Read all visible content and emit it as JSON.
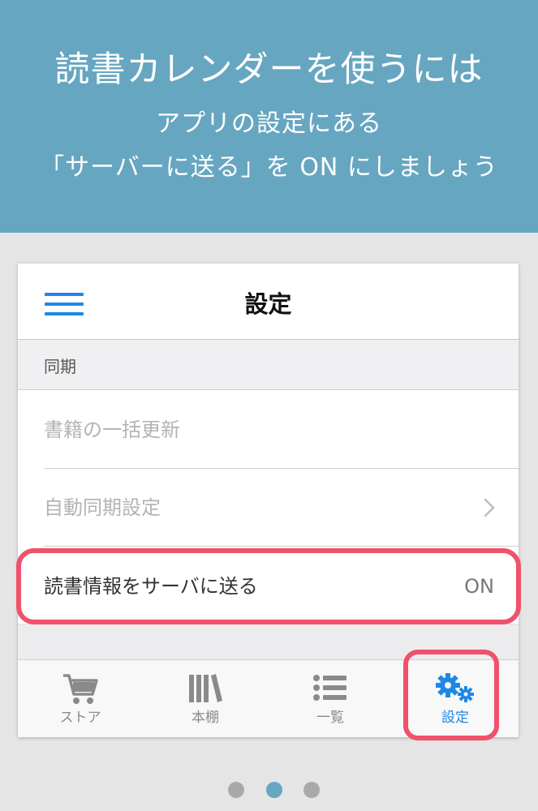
{
  "banner": {
    "title": "読書カレンダーを使うには",
    "line1": "アプリの設定にある",
    "line2": "「サーバーに送る」を ON にしましょう",
    "color": "#67a6c0"
  },
  "header": {
    "title": "設定",
    "menu_icon": "hamburger-menu-icon"
  },
  "section": {
    "label": "同期"
  },
  "rows": [
    {
      "label": "書籍の一括更新",
      "enabled": false
    },
    {
      "label": "自動同期設定",
      "enabled": false,
      "icon": "chevron-right-icon"
    },
    {
      "label": "読書情報をサーバに送る",
      "enabled": true,
      "value": "ON"
    }
  ],
  "tabs": [
    {
      "label": "ストア",
      "icon": "cart-icon",
      "active": false
    },
    {
      "label": "本棚",
      "icon": "bookshelf-icon",
      "active": false
    },
    {
      "label": "一覧",
      "icon": "list-icon",
      "active": false
    },
    {
      "label": "設定",
      "icon": "gears-icon",
      "active": true
    }
  ],
  "pager": {
    "count": 3,
    "current": 2
  },
  "colors": {
    "accent": "#1e88e5",
    "highlight": "#f0516b"
  }
}
